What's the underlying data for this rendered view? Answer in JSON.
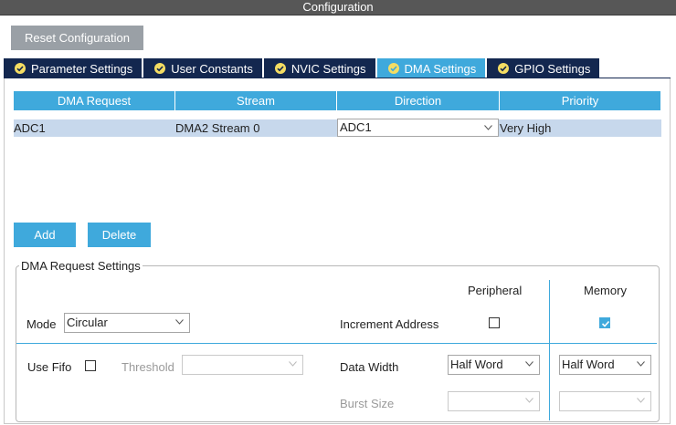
{
  "window": {
    "title": "Configuration"
  },
  "toolbar": {
    "reset_label": "Reset Configuration"
  },
  "tabs": [
    {
      "label": "Parameter Settings",
      "icon": "check-circle-icon",
      "active": false
    },
    {
      "label": "User Constants",
      "icon": "check-circle-icon",
      "active": false
    },
    {
      "label": "NVIC Settings",
      "icon": "check-circle-icon",
      "active": false
    },
    {
      "label": "DMA Settings",
      "icon": "check-circle-icon",
      "active": true
    },
    {
      "label": "GPIO Settings",
      "icon": "check-circle-icon",
      "active": false
    }
  ],
  "dma_table": {
    "columns": [
      "DMA Request",
      "Stream",
      "Direction",
      "Priority"
    ],
    "rows": [
      {
        "request": "ADC1",
        "stream": "DMA2 Stream 0",
        "direction": "ADC1",
        "priority": "Very High"
      }
    ]
  },
  "actions": {
    "add_label": "Add",
    "delete_label": "Delete"
  },
  "settings": {
    "legend": "DMA Request Settings",
    "peripheral_header": "Peripheral",
    "memory_header": "Memory",
    "mode_label": "Mode",
    "mode_value": "Circular",
    "increment_label": "Increment Address",
    "peripheral_increment": false,
    "memory_increment": true,
    "use_fifo_label": "Use Fifo",
    "use_fifo": false,
    "threshold_label": "Threshold",
    "threshold_value": "",
    "data_width_label": "Data Width",
    "peripheral_data_width": "Half Word",
    "memory_data_width": "Half Word",
    "burst_size_label": "Burst Size",
    "peripheral_burst": "",
    "memory_burst": ""
  },
  "colors": {
    "accent": "#3fa9dc",
    "tab_dark": "#13274f",
    "row_selected": "#c7d8ec",
    "title_bar": "#575757",
    "icon_yellow": "#f4dd63"
  }
}
